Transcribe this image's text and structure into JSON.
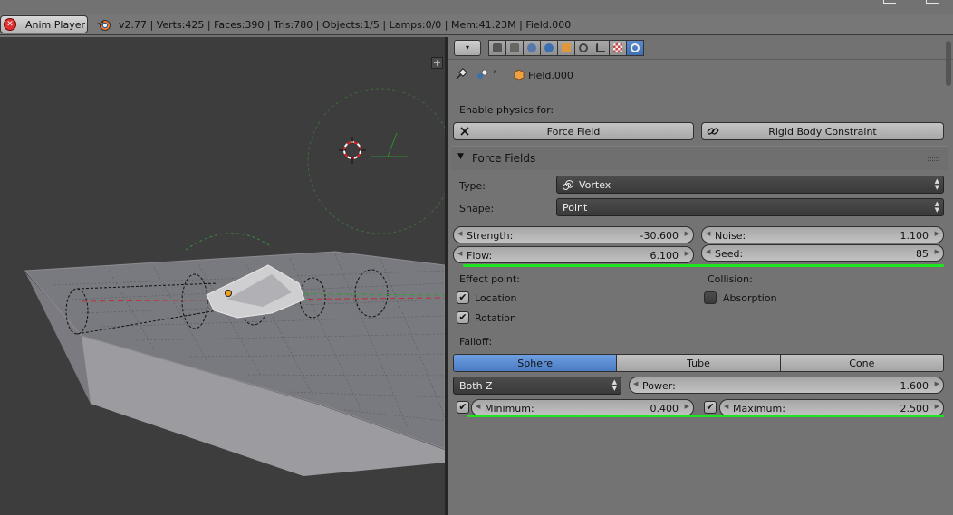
{
  "topbar": {
    "player_label": "Anim Player",
    "stats": "v2.77 | Verts:425 | Faces:390 | Tris:780 | Objects:1/5 | Lamps:0/0 | Mem:41.23M | Field.000"
  },
  "viewport": {
    "plus_label": "+"
  },
  "props": {
    "editor_type_label": "▾",
    "context_tabs": [
      "render",
      "render-layers",
      "scene",
      "world",
      "object",
      "constraints",
      "modifiers",
      "data",
      "physics"
    ],
    "breadcrumb_object": "Field.000",
    "enable_label": "Enable physics for:",
    "force_field_btn": "Force Field",
    "rigid_constraint_btn": "Rigid Body Constraint",
    "panel_title": "Force Fields",
    "type_label": "Type:",
    "type_value": "Vortex",
    "shape_label": "Shape:",
    "shape_value": "Point",
    "strength_label": "Strength:",
    "strength_value": "-30.600",
    "noise_label": "Noise:",
    "noise_value": "1.100",
    "flow_label": "Flow:",
    "flow_value": "6.100",
    "seed_label": "Seed:",
    "seed_value": "85",
    "effect_point_label": "Effect point:",
    "location_label": "Location",
    "rotation_label": "Rotation",
    "collision_label": "Collision:",
    "absorption_label": "Absorption",
    "falloff_label": "Falloff:",
    "falloff_tabs": [
      "Sphere",
      "Tube",
      "Cone"
    ],
    "falloff_selected": "Sphere",
    "both_z_value": "Both Z",
    "power_label": "Power:",
    "power_value": "1.600",
    "minimum_label": "Minimum:",
    "minimum_value": "0.400",
    "maximum_label": "Maximum:",
    "maximum_value": "2.500",
    "checks": {
      "location": true,
      "rotation": true,
      "absorption": false,
      "minimum": true,
      "maximum": true
    }
  },
  "colors": {
    "selected_tab": "#5a8bd0",
    "annotation_underline": "#1ee61e",
    "panel_bg": "#737373",
    "viewport_bg": "#3d3d3d"
  }
}
